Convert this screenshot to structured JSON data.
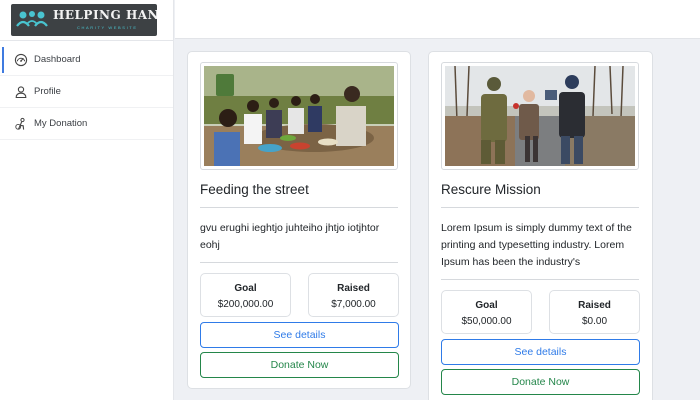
{
  "brand": {
    "name": "HELPING HANDS",
    "subtitle": "CHARITY WEBSITE",
    "logo_icon": "people-group-icon",
    "colors": {
      "background": "#3d4144",
      "accent": "#49c4d0"
    }
  },
  "sidebar": {
    "items": [
      {
        "label": "Dashboard",
        "icon": "gauge-icon",
        "active": true
      },
      {
        "label": "Profile",
        "icon": "user-icon",
        "active": false
      },
      {
        "label": "My Donation",
        "icon": "donation-hand-icon",
        "active": false
      }
    ]
  },
  "campaigns": [
    {
      "title": "Feeding the street",
      "description": "gvu erughi ieghtjo juhteiho jhtjo iotjhtor eohj",
      "goal_label": "Goal",
      "goal_value": "$200,000.00",
      "raised_label": "Raised",
      "raised_value": "$7,000.00",
      "details_label": "See details",
      "donate_label": "Donate Now"
    },
    {
      "title": "Rescure Mission",
      "description": "Lorem Ipsum is simply dummy text of the printing and typesetting industry. Lorem Ipsum has been the industry's",
      "goal_label": "Goal",
      "goal_value": "$50,000.00",
      "raised_label": "Raised",
      "raised_value": "$0.00",
      "details_label": "See details",
      "donate_label": "Donate Now"
    }
  ],
  "colors": {
    "primary": "#2f7be8",
    "success": "#24864a",
    "background": "#eef0f4",
    "active_indicator": "#3f7be0"
  }
}
